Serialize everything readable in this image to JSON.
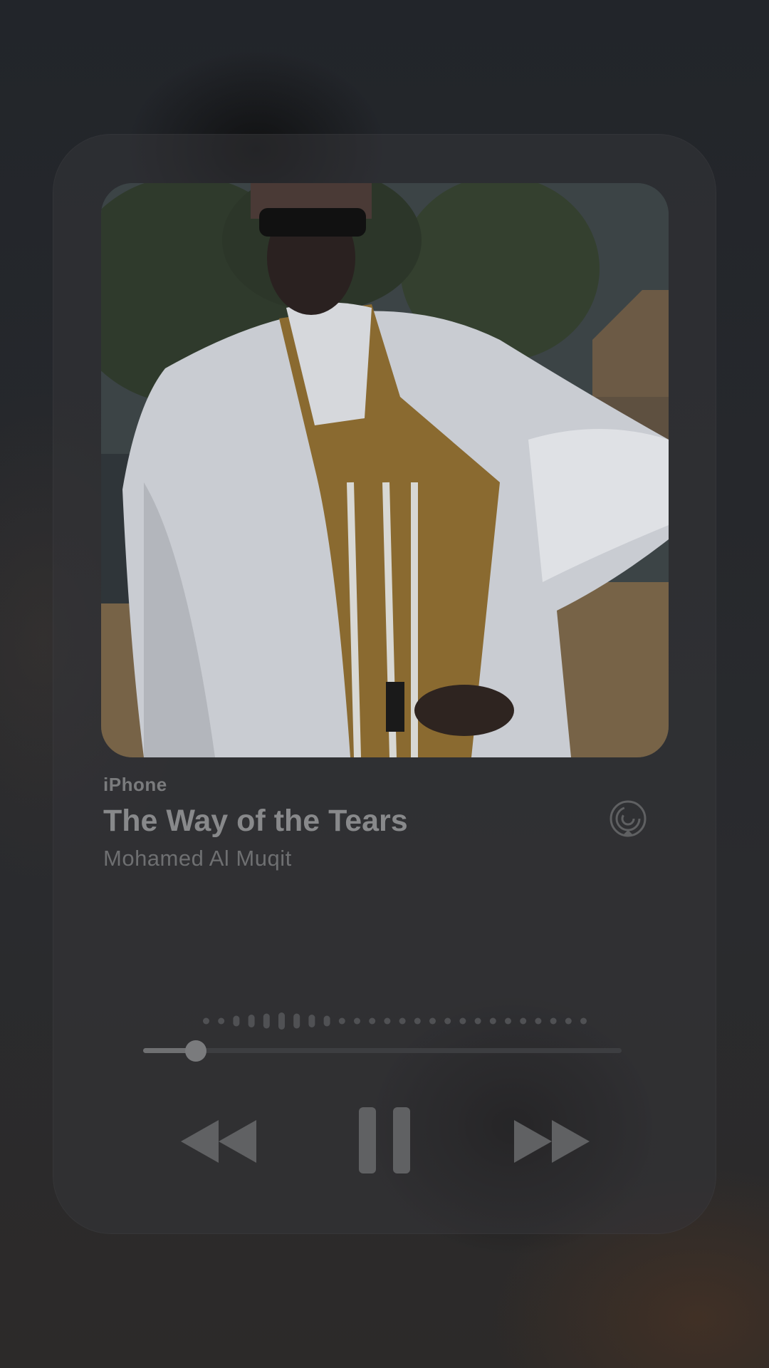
{
  "player": {
    "source": "iPhone",
    "title": "The Way of the Tears",
    "artist": "Mohamed Al Muqit",
    "progress_fraction": 0.05,
    "controls": {
      "rewind": "rewind-icon",
      "pause": "pause-icon",
      "forward": "fast-forward-icon",
      "airplay": "airplay-icon"
    },
    "colors": {
      "card": "#343538",
      "text_primary": "#88898b",
      "text_secondary": "#6e6f71",
      "control": "#6f7072"
    }
  }
}
